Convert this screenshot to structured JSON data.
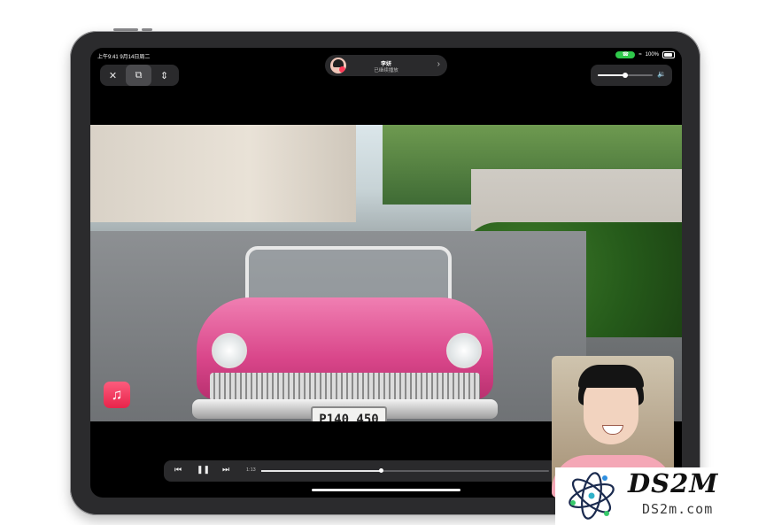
{
  "status_bar": {
    "time_date": "上午9:41  9月14日周二",
    "facetime_pill": "☎",
    "battery_percent": "100%"
  },
  "top_left_controls": {
    "close_icon": "✕",
    "screen_icon": "⧉",
    "split_icon": "⇕"
  },
  "caller": {
    "name": "李妍",
    "status": "已继续播放",
    "chevron": "›"
  },
  "volume": {
    "level": 0.5,
    "icon": "🔉"
  },
  "video": {
    "plate_text": "P140 450",
    "music_icon": "♫"
  },
  "playback": {
    "prev_icon": "⏮",
    "pause_icon": "❚❚",
    "next_icon": "⏭",
    "elapsed": "1:13",
    "progress": 0.415
  },
  "watermark": {
    "title": "DS2M",
    "url": "DS2m.com"
  }
}
